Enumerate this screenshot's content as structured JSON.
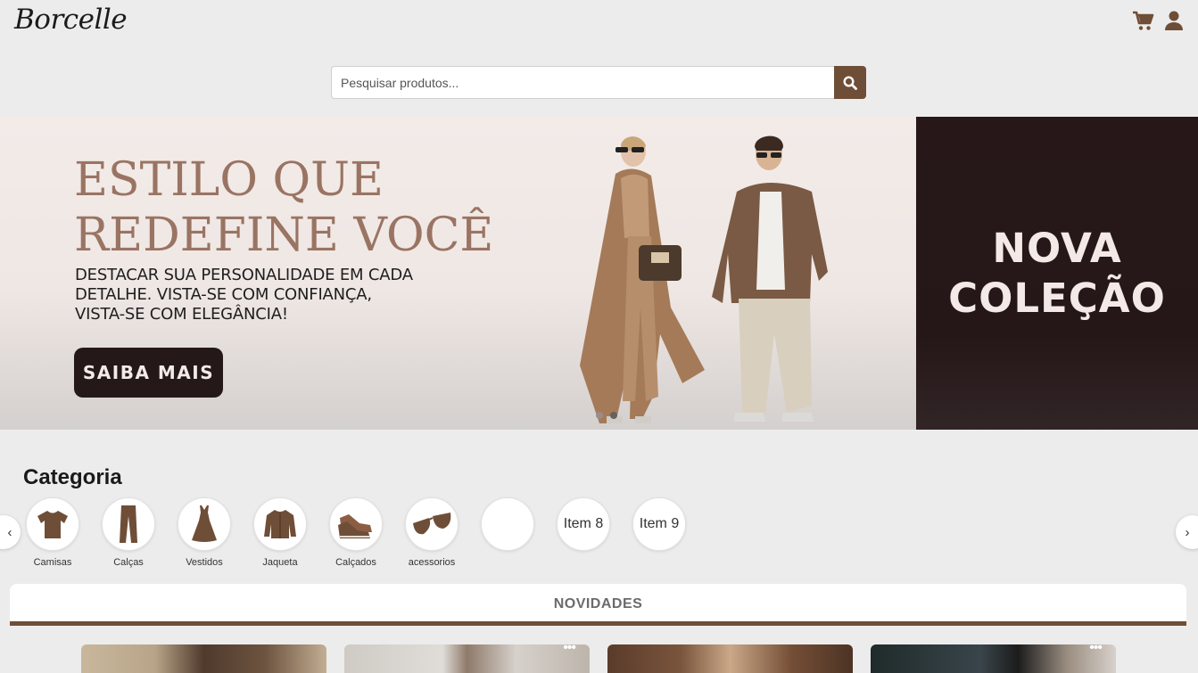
{
  "brand": {
    "logo_text": "Borcelle"
  },
  "header": {
    "cart_icon": "cart-icon",
    "user_icon": "user-icon"
  },
  "search": {
    "placeholder": "Pesquisar produtos...",
    "value": "",
    "button_icon": "search-icon"
  },
  "banner": {
    "headline_line1": "ESTILO QUE",
    "headline_line2": "REDEFINE VOCÊ",
    "sub_line1": "DESTACAR SUA PERSONALIDADE EM CADA",
    "sub_line2": "DETALHE. VISTA-SE COM CONFIANÇA,",
    "sub_line3": "VISTA-SE COM ELEGÂNCIA!",
    "cta_label": "SAIBA MAIS",
    "side_line1": "NOVA",
    "side_line2": "COLEÇÃO",
    "active_slide": 1,
    "slide_count": 2
  },
  "categories": {
    "title": "Categoria",
    "prev_label": "‹",
    "next_label": "›",
    "items": [
      {
        "label": "Camisas",
        "icon": "tshirt-icon"
      },
      {
        "label": "Calças",
        "icon": "pants-icon"
      },
      {
        "label": "Vestidos",
        "icon": "dress-icon"
      },
      {
        "label": "Jaqueta",
        "icon": "jacket-icon"
      },
      {
        "label": "Calçados",
        "icon": "sneakers-icon"
      },
      {
        "label": "acessorios",
        "icon": "sunglasses-icon"
      },
      {
        "label": "",
        "icon": ""
      },
      {
        "label": "",
        "circle_text": "Item 8"
      },
      {
        "label": "",
        "circle_text": "Item 9"
      }
    ]
  },
  "novidades": {
    "title": "NOVIDADES"
  },
  "colors": {
    "accent": "#6f4e37",
    "banner_dark": "#271718",
    "headline": "#9a7463",
    "background": "#ececec"
  }
}
